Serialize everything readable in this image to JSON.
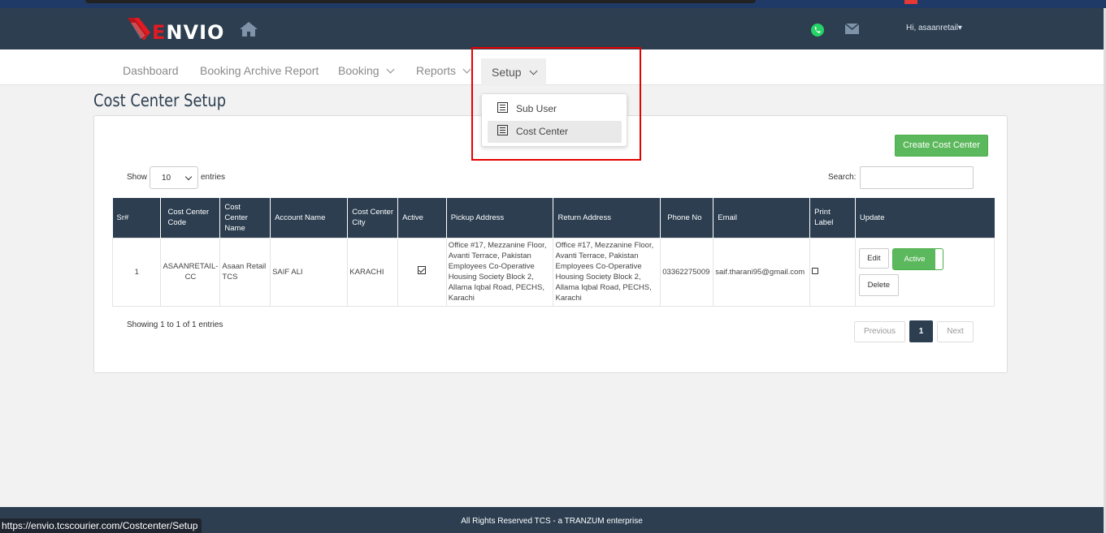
{
  "header": {
    "logo_mark": "E",
    "logo_text": "NVIO",
    "user_greeting": "Hi, asaanretail",
    "icons": [
      "home-icon",
      "whatsapp-icon",
      "mail-icon"
    ]
  },
  "nav": {
    "items": [
      {
        "label": "Dashboard"
      },
      {
        "label": "Booking Archive Report"
      },
      {
        "label": "Booking"
      },
      {
        "label": "Reports"
      },
      {
        "label": "Setup"
      }
    ],
    "setup_menu": [
      {
        "label": "Sub User",
        "icon": "list-icon"
      },
      {
        "label": "Cost Center",
        "icon": "list-icon",
        "active": true
      }
    ]
  },
  "page": {
    "title": "Cost Center Setup",
    "create_button": "Create Cost Center",
    "show_label": "Show",
    "entries_value": "10",
    "entries_label": "entries",
    "search_label": "Search:",
    "search_value": ""
  },
  "table": {
    "headers": [
      "Sr#",
      "Cost Center Code",
      "Cost Center Name",
      "Account Name",
      "Cost Center City",
      "Active",
      "Pickup Address",
      "Return Address",
      "Phone No",
      "Email",
      "Print Label",
      "Update"
    ],
    "rows": [
      {
        "sr": "1",
        "code": "ASAANRETAIL-CC",
        "name": "Asaan Retail TCS",
        "account": "SAIF ALI",
        "city": "KARACHI",
        "active": true,
        "pickup": "Office #17, Mezzanine Floor, Avanti Terrace, Pakistan Employees Co-Operative Housing Society Block 2, Allama Iqbal Road, PECHS, Karachi",
        "return": "Office #17, Mezzanine Floor, Avanti Terrace, Pakistan Employees Co-Operative Housing Society Block 2, Allama Iqbal Road, PECHS, Karachi",
        "phone": "03362275009",
        "email": "saif.tharani95@gmail.com",
        "print_label": false,
        "edit_label": "Edit",
        "toggle_label": "Active",
        "delete_label": "Delete"
      }
    ]
  },
  "pagination": {
    "info": "Showing 1 to 1 of 1 entries",
    "prev": "Previous",
    "current": "1",
    "next": "Next"
  },
  "footer": {
    "text": "All Rights Reserved TCS - a TRANZUM enterprise",
    "status_url": "https://envio.tcscourier.com/Costcenter/Setup"
  },
  "colors": {
    "header_bg": "#2c3e50",
    "accent_green": "#5cb85c",
    "brand_red": "#e21b23",
    "highlight_red": "#e60000"
  }
}
